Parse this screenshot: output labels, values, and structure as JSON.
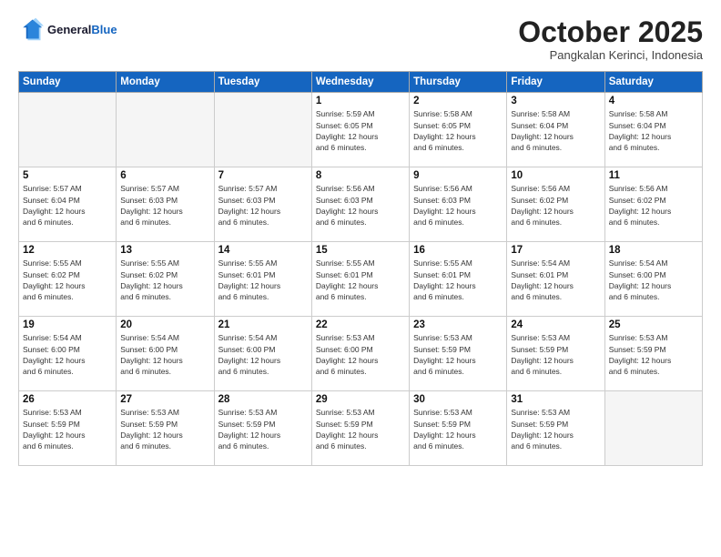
{
  "header": {
    "logo_line1": "General",
    "logo_line2": "Blue",
    "month_title": "October 2025",
    "subtitle": "Pangkalan Kerinci, Indonesia"
  },
  "weekdays": [
    "Sunday",
    "Monday",
    "Tuesday",
    "Wednesday",
    "Thursday",
    "Friday",
    "Saturday"
  ],
  "weeks": [
    [
      {
        "day": "",
        "info": ""
      },
      {
        "day": "",
        "info": ""
      },
      {
        "day": "",
        "info": ""
      },
      {
        "day": "1",
        "info": "Sunrise: 5:59 AM\nSunset: 6:05 PM\nDaylight: 12 hours\nand 6 minutes."
      },
      {
        "day": "2",
        "info": "Sunrise: 5:58 AM\nSunset: 6:05 PM\nDaylight: 12 hours\nand 6 minutes."
      },
      {
        "day": "3",
        "info": "Sunrise: 5:58 AM\nSunset: 6:04 PM\nDaylight: 12 hours\nand 6 minutes."
      },
      {
        "day": "4",
        "info": "Sunrise: 5:58 AM\nSunset: 6:04 PM\nDaylight: 12 hours\nand 6 minutes."
      }
    ],
    [
      {
        "day": "5",
        "info": "Sunrise: 5:57 AM\nSunset: 6:04 PM\nDaylight: 12 hours\nand 6 minutes."
      },
      {
        "day": "6",
        "info": "Sunrise: 5:57 AM\nSunset: 6:03 PM\nDaylight: 12 hours\nand 6 minutes."
      },
      {
        "day": "7",
        "info": "Sunrise: 5:57 AM\nSunset: 6:03 PM\nDaylight: 12 hours\nand 6 minutes."
      },
      {
        "day": "8",
        "info": "Sunrise: 5:56 AM\nSunset: 6:03 PM\nDaylight: 12 hours\nand 6 minutes."
      },
      {
        "day": "9",
        "info": "Sunrise: 5:56 AM\nSunset: 6:03 PM\nDaylight: 12 hours\nand 6 minutes."
      },
      {
        "day": "10",
        "info": "Sunrise: 5:56 AM\nSunset: 6:02 PM\nDaylight: 12 hours\nand 6 minutes."
      },
      {
        "day": "11",
        "info": "Sunrise: 5:56 AM\nSunset: 6:02 PM\nDaylight: 12 hours\nand 6 minutes."
      }
    ],
    [
      {
        "day": "12",
        "info": "Sunrise: 5:55 AM\nSunset: 6:02 PM\nDaylight: 12 hours\nand 6 minutes."
      },
      {
        "day": "13",
        "info": "Sunrise: 5:55 AM\nSunset: 6:02 PM\nDaylight: 12 hours\nand 6 minutes."
      },
      {
        "day": "14",
        "info": "Sunrise: 5:55 AM\nSunset: 6:01 PM\nDaylight: 12 hours\nand 6 minutes."
      },
      {
        "day": "15",
        "info": "Sunrise: 5:55 AM\nSunset: 6:01 PM\nDaylight: 12 hours\nand 6 minutes."
      },
      {
        "day": "16",
        "info": "Sunrise: 5:55 AM\nSunset: 6:01 PM\nDaylight: 12 hours\nand 6 minutes."
      },
      {
        "day": "17",
        "info": "Sunrise: 5:54 AM\nSunset: 6:01 PM\nDaylight: 12 hours\nand 6 minutes."
      },
      {
        "day": "18",
        "info": "Sunrise: 5:54 AM\nSunset: 6:00 PM\nDaylight: 12 hours\nand 6 minutes."
      }
    ],
    [
      {
        "day": "19",
        "info": "Sunrise: 5:54 AM\nSunset: 6:00 PM\nDaylight: 12 hours\nand 6 minutes."
      },
      {
        "day": "20",
        "info": "Sunrise: 5:54 AM\nSunset: 6:00 PM\nDaylight: 12 hours\nand 6 minutes."
      },
      {
        "day": "21",
        "info": "Sunrise: 5:54 AM\nSunset: 6:00 PM\nDaylight: 12 hours\nand 6 minutes."
      },
      {
        "day": "22",
        "info": "Sunrise: 5:53 AM\nSunset: 6:00 PM\nDaylight: 12 hours\nand 6 minutes."
      },
      {
        "day": "23",
        "info": "Sunrise: 5:53 AM\nSunset: 5:59 PM\nDaylight: 12 hours\nand 6 minutes."
      },
      {
        "day": "24",
        "info": "Sunrise: 5:53 AM\nSunset: 5:59 PM\nDaylight: 12 hours\nand 6 minutes."
      },
      {
        "day": "25",
        "info": "Sunrise: 5:53 AM\nSunset: 5:59 PM\nDaylight: 12 hours\nand 6 minutes."
      }
    ],
    [
      {
        "day": "26",
        "info": "Sunrise: 5:53 AM\nSunset: 5:59 PM\nDaylight: 12 hours\nand 6 minutes."
      },
      {
        "day": "27",
        "info": "Sunrise: 5:53 AM\nSunset: 5:59 PM\nDaylight: 12 hours\nand 6 minutes."
      },
      {
        "day": "28",
        "info": "Sunrise: 5:53 AM\nSunset: 5:59 PM\nDaylight: 12 hours\nand 6 minutes."
      },
      {
        "day": "29",
        "info": "Sunrise: 5:53 AM\nSunset: 5:59 PM\nDaylight: 12 hours\nand 6 minutes."
      },
      {
        "day": "30",
        "info": "Sunrise: 5:53 AM\nSunset: 5:59 PM\nDaylight: 12 hours\nand 6 minutes."
      },
      {
        "day": "31",
        "info": "Sunrise: 5:53 AM\nSunset: 5:59 PM\nDaylight: 12 hours\nand 6 minutes."
      },
      {
        "day": "",
        "info": ""
      }
    ]
  ]
}
